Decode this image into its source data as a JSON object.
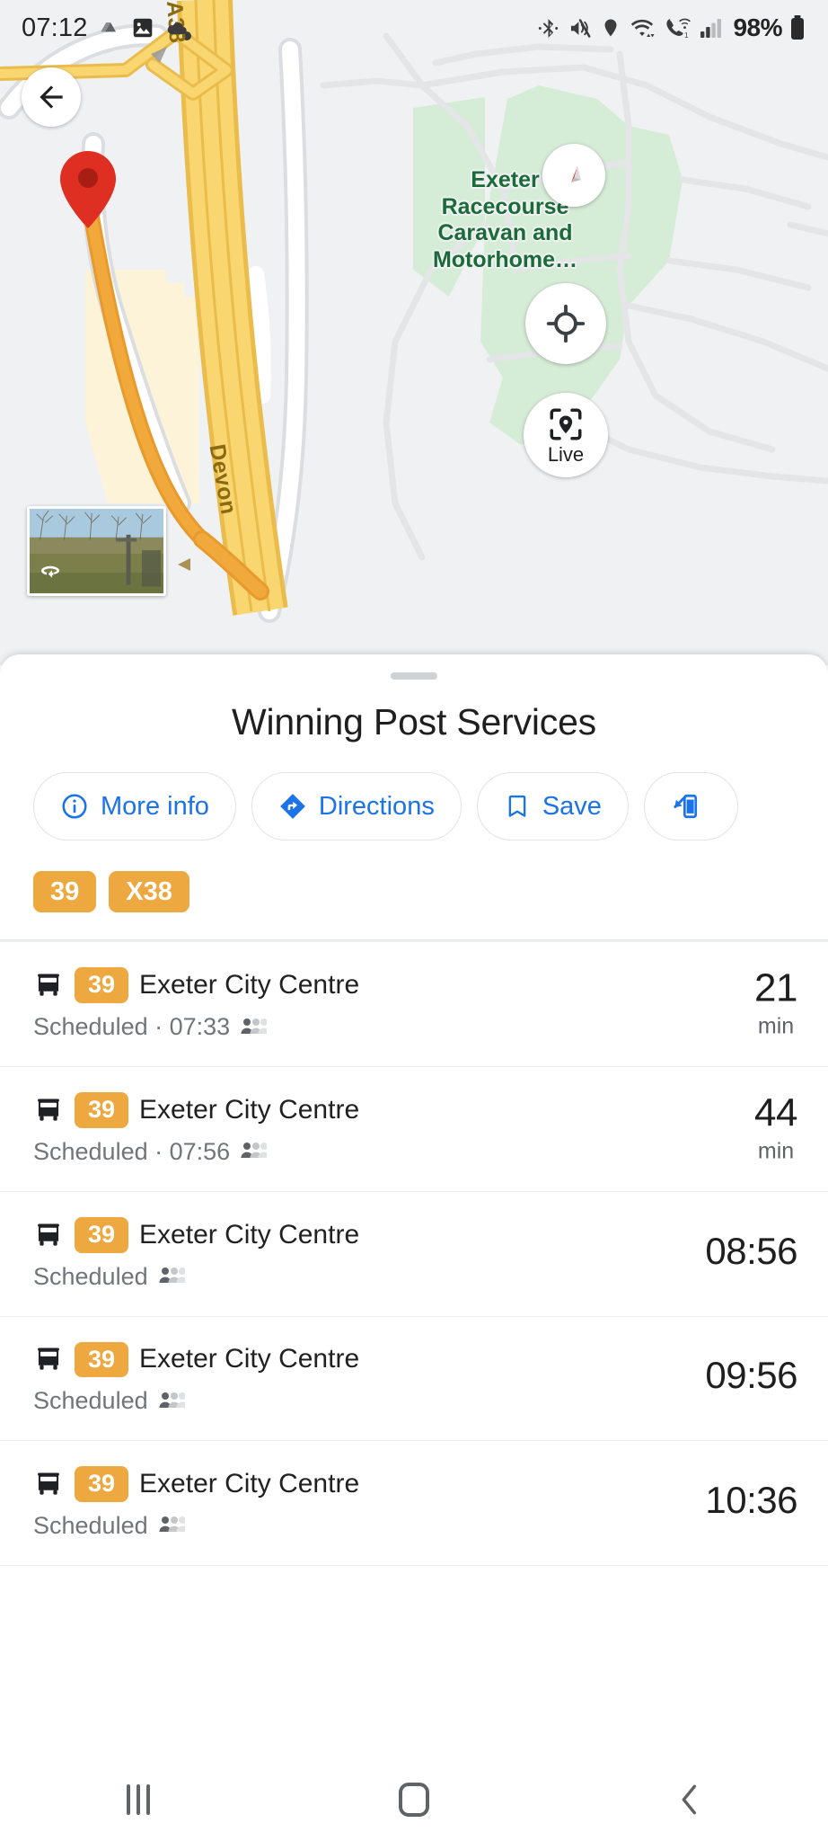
{
  "statusbar": {
    "time": "07:12",
    "left_icons": [
      "drive-icon",
      "photos-icon",
      "cloud-icon"
    ],
    "right_icons": [
      "bluetooth-icon",
      "mute-icon",
      "location-icon",
      "wifi-icon",
      "wifi-calling-icon",
      "signal-icon"
    ],
    "battery_percent": "98%",
    "battery_icon": "battery-full-icon"
  },
  "map": {
    "poi_label": "Exeter Racecourse Caravan and Motorhome…",
    "road_labels": [
      "A38",
      "Devon"
    ],
    "back_icon": "back-arrow-icon",
    "compass_icon": "compass-icon",
    "locate_icon": "my-location-icon",
    "live_label": "Live",
    "live_icon": "live-view-icon",
    "marker_icon": "map-pin-icon",
    "streetview_icon": "streetview-rotate-icon",
    "colors": {
      "background": "#f0f1f3",
      "park_green": "#d5ecd7",
      "motorway_yellow": "#f9d66f",
      "road_orange": "#f2a93b",
      "marker_red": "#df2f23",
      "poi_text": "#1a6b38"
    }
  },
  "sheet": {
    "title": "Winning Post Services",
    "chips": [
      {
        "label": "More info",
        "icon": "info-circle-icon"
      },
      {
        "label": "Directions",
        "icon": "directions-icon"
      },
      {
        "label": "Save",
        "icon": "bookmark-icon"
      },
      {
        "label": "",
        "icon": "send-to-phone-icon"
      }
    ],
    "route_badges": [
      "39",
      "X38"
    ],
    "accent_orange": "#eda83f",
    "accent_blue": "#1a73e8"
  },
  "departures": [
    {
      "route": "39",
      "destination": "Exeter City Centre",
      "status": "Scheduled · 07:33",
      "occupancy_icon": "occupancy-icon",
      "bus_icon": "bus-icon",
      "value": "21",
      "unit": "min"
    },
    {
      "route": "39",
      "destination": "Exeter City Centre",
      "status": "Scheduled · 07:56",
      "occupancy_icon": "occupancy-icon",
      "bus_icon": "bus-icon",
      "value": "44",
      "unit": "min"
    },
    {
      "route": "39",
      "destination": "Exeter City Centre",
      "status": "Scheduled",
      "occupancy_icon": "occupancy-icon",
      "bus_icon": "bus-icon",
      "value": "08:56",
      "unit": ""
    },
    {
      "route": "39",
      "destination": "Exeter City Centre",
      "status": "Scheduled",
      "occupancy_icon": "occupancy-icon",
      "bus_icon": "bus-icon",
      "value": "09:56",
      "unit": ""
    },
    {
      "route": "39",
      "destination": "Exeter City Centre",
      "status": "Scheduled",
      "occupancy_icon": "occupancy-icon",
      "bus_icon": "bus-icon",
      "value": "10:36",
      "unit": ""
    }
  ],
  "navbar": {
    "recents_icon": "recents-icon",
    "home_icon": "home-icon",
    "back_icon": "back-icon"
  }
}
